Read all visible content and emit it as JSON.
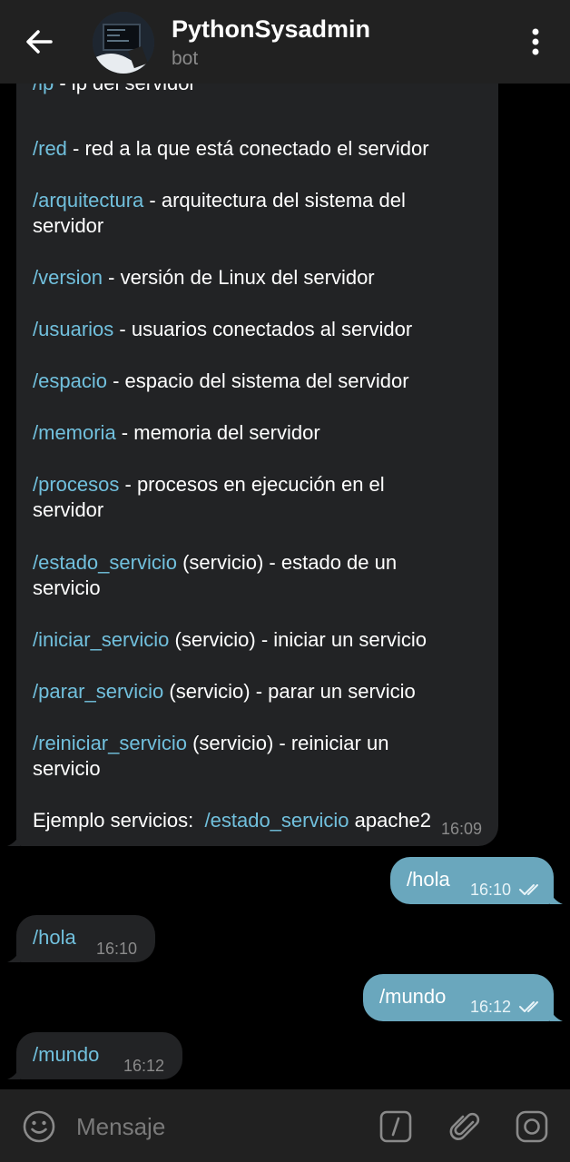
{
  "header": {
    "title": "PythonSysadmin",
    "subtitle": "bot"
  },
  "help_message": {
    "lines": [
      {
        "cmd": "/ip",
        "text": " - ip del servidor"
      },
      {
        "cmd": "/red",
        "text": " - red a la que está conectado el servidor"
      },
      {
        "cmd": "/arquitectura",
        "text": " - arquitectura del sistema del",
        "cont": "servidor"
      },
      {
        "cmd": "/version",
        "text": " - versión de Linux del servidor"
      },
      {
        "cmd": "/usuarios",
        "text": " - usuarios conectados al servidor"
      },
      {
        "cmd": "/espacio",
        "text": " - espacio del sistema del servidor"
      },
      {
        "cmd": "/memoria",
        "text": " - memoria del servidor"
      },
      {
        "cmd": "/procesos",
        "text": " - procesos en ejecución en el",
        "cont": "servidor"
      },
      {
        "cmd": "/estado_servicio",
        "text": " (servicio) - estado de un",
        "cont": "servicio"
      },
      {
        "cmd": "/iniciar_servicio",
        "text": " (servicio) - iniciar un servicio"
      },
      {
        "cmd": "/parar_servicio",
        "text": " (servicio) - parar un servicio"
      },
      {
        "cmd": "/reiniciar_servicio",
        "text": " (servicio) - reiniciar un",
        "cont": "servicio"
      }
    ],
    "example_prefix": "Ejemplo servicios:  ",
    "example_cmd": "/estado_servicio",
    "example_suffix": " apache2",
    "time": "16:09"
  },
  "messages": [
    {
      "dir": "out",
      "text": "/hola",
      "time": "16:10"
    },
    {
      "dir": "in",
      "text": "/hola",
      "time": "16:10"
    },
    {
      "dir": "out",
      "text": "/mundo",
      "time": "16:12"
    },
    {
      "dir": "in",
      "text": "/mundo",
      "time": "16:12"
    }
  ],
  "input": {
    "placeholder": "Mensaje"
  },
  "icons": {
    "back": "back-arrow-icon",
    "menu": "more-vertical-icon",
    "emoji": "emoji-icon",
    "commands": "slash-command-icon",
    "attach": "paperclip-icon",
    "camera": "camera-icon",
    "read": "double-check-icon"
  },
  "colors": {
    "accent_link": "#71c0dd",
    "outgoing_bubble": "#6aa7bd",
    "incoming_bubble": "#222325",
    "header_bg": "#212121"
  }
}
